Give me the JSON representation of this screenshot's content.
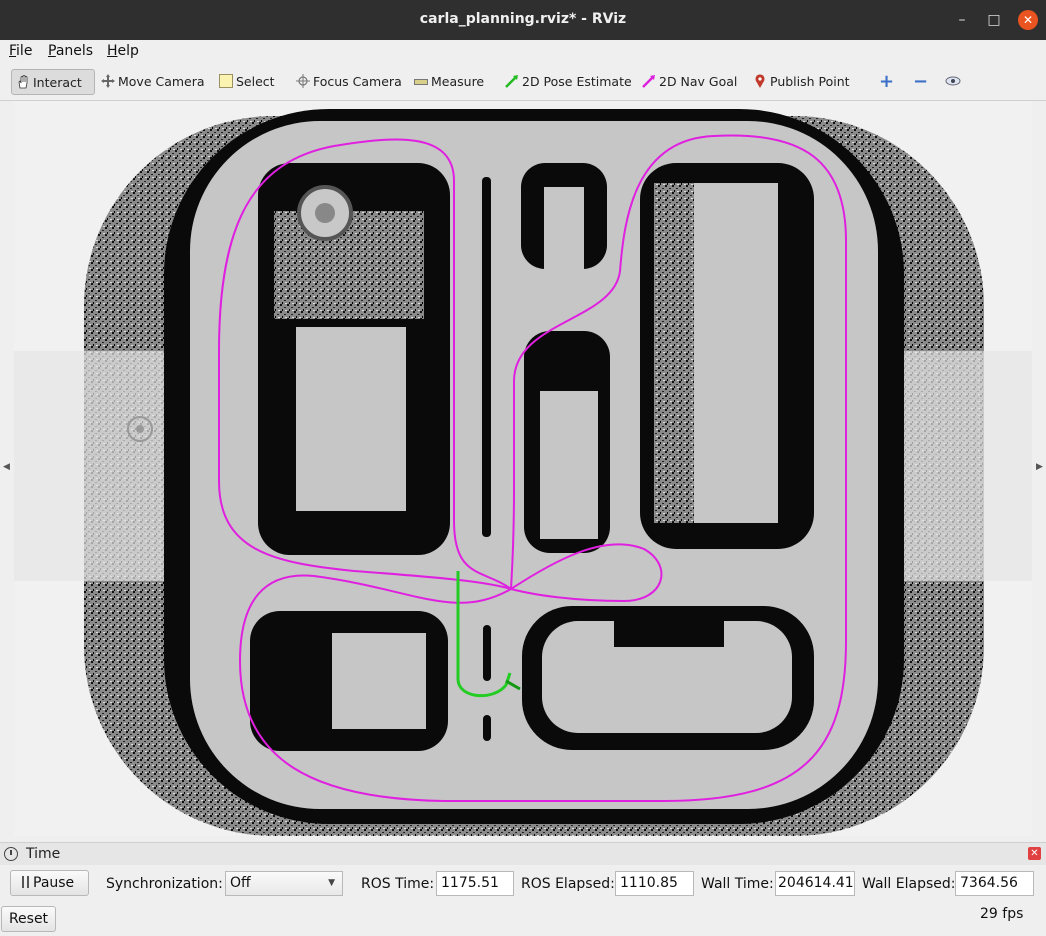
{
  "window": {
    "title": "carla_planning.rviz* - RViz",
    "minimize_glyph": "–",
    "maximize_glyph": "□",
    "close_glyph": "✕"
  },
  "menu": {
    "file": "File",
    "panels": "Panels",
    "help": "Help"
  },
  "toolbar": {
    "interact": "Interact",
    "move_camera": "Move Camera",
    "select": "Select",
    "focus_camera": "Focus Camera",
    "measure": "Measure",
    "pose_estimate": "2D Pose Estimate",
    "nav_goal": "2D Nav Goal",
    "publish_point": "Publish Point",
    "zoom_in_glyph": "+",
    "zoom_out_glyph": "−"
  },
  "colors": {
    "planned_path": "#e020e0",
    "local_path": "#22cc22",
    "obstacle": "#000000",
    "free": "#c8c8c8",
    "accent_close": "#e95420"
  },
  "time_panel": {
    "header": "Time",
    "pause_label": "Pause",
    "sync_label": "Synchronization:",
    "sync_value": "Off",
    "ros_time_label": "ROS Time:",
    "ros_time_value": "1175.51",
    "ros_elapsed_label": "ROS Elapsed:",
    "ros_elapsed_value": "1110.85",
    "wall_time_label": "Wall Time:",
    "wall_time_value": "204614.41",
    "wall_elapsed_label": "Wall Elapsed:",
    "wall_elapsed_value": "7364.56"
  },
  "footer": {
    "reset_label": "Reset",
    "fps": "29 fps"
  }
}
